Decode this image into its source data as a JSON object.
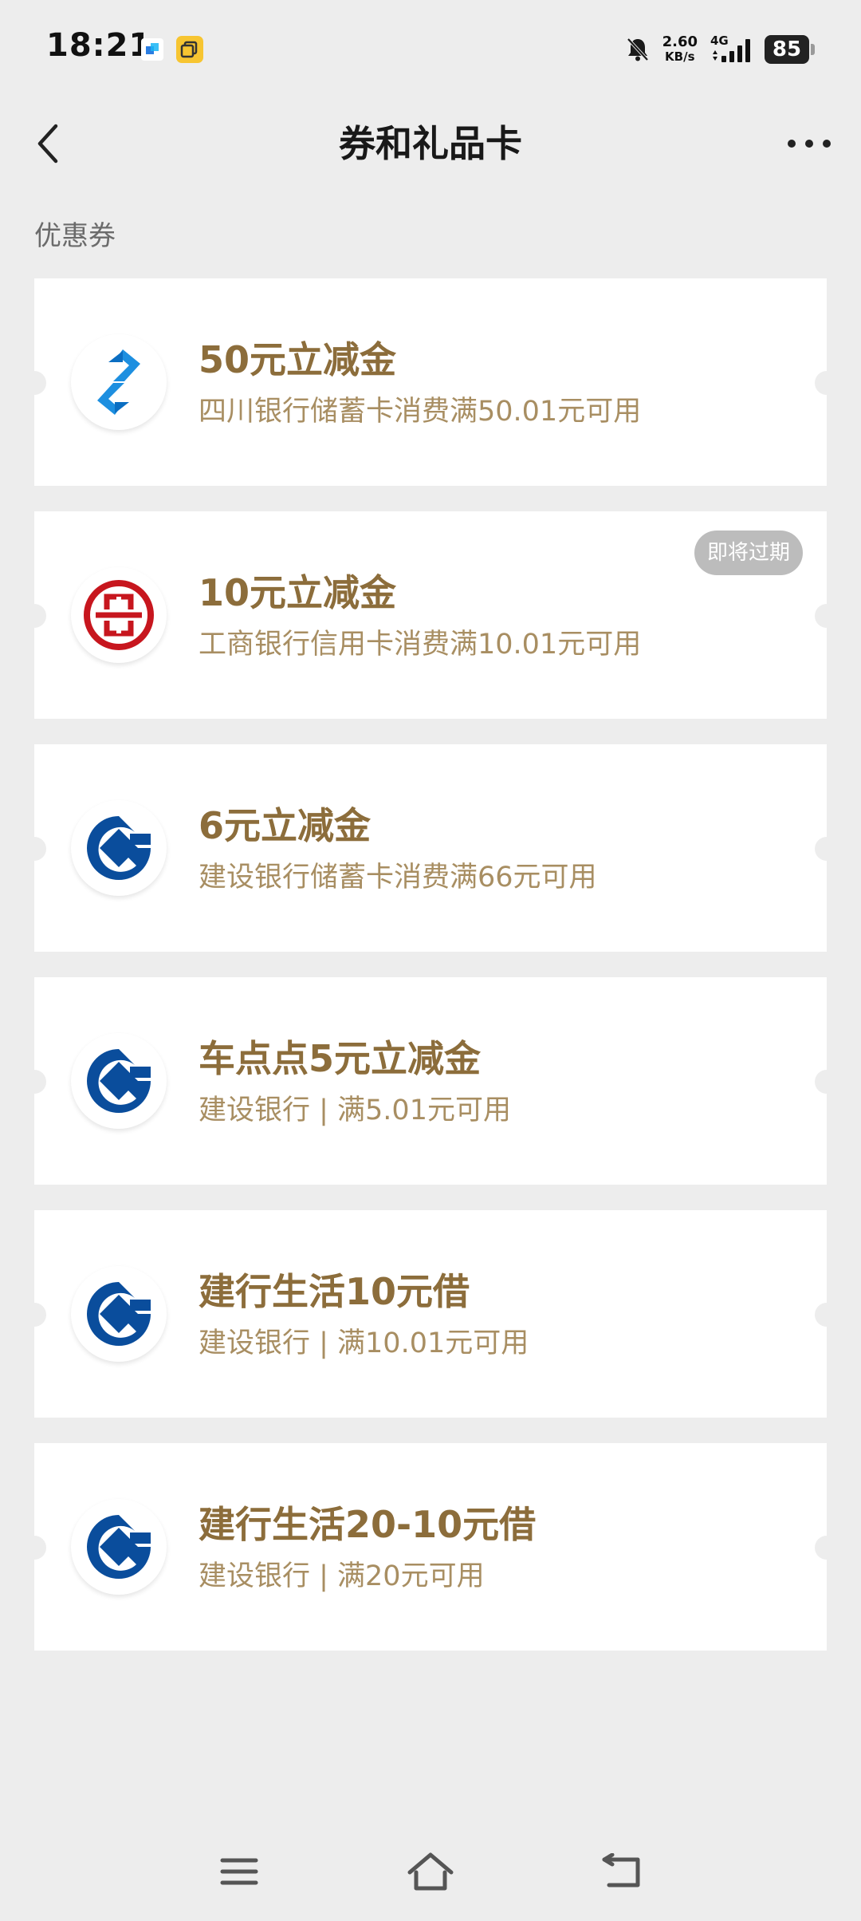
{
  "status_bar": {
    "time": "18:21",
    "net_speed": "2.60",
    "net_speed_unit": "KB/s",
    "network_type": "4G",
    "battery": "85"
  },
  "header": {
    "title": "券和礼品卡",
    "back_icon": "chevron-left-icon",
    "more_icon": "more-horizontal-icon"
  },
  "section": {
    "label": "优惠券"
  },
  "coupons": [
    {
      "logo": "sichuan-bank-logo",
      "title": "50元立减金",
      "desc": "四川银行储蓄卡消费满50.01元可用",
      "badge": ""
    },
    {
      "logo": "icbc-logo",
      "title": "10元立减金",
      "desc": "工商银行信用卡消费满10.01元可用",
      "badge": "即将过期"
    },
    {
      "logo": "ccb-logo",
      "title": "6元立减金",
      "desc": "建设银行储蓄卡消费满66元可用",
      "badge": ""
    },
    {
      "logo": "ccb-logo",
      "title": "车点点5元立减金",
      "desc": "建设银行 | 满5.01元可用",
      "badge": ""
    },
    {
      "logo": "ccb-logo",
      "title": "建行生活10元借",
      "desc": "建设银行 | 满10.01元可用",
      "badge": ""
    },
    {
      "logo": "ccb-logo",
      "title": "建行生活20-10元借",
      "desc": "建设银行 | 满20元可用",
      "badge": ""
    }
  ],
  "colors": {
    "background": "#ededed",
    "title_gold": "#8c6d3b",
    "desc_gold": "#a88e62",
    "ccb_blue": "#0a4d9c",
    "icbc_red": "#c7161e",
    "sichuan_blue": "#1d8fe0"
  },
  "bottom_nav": {
    "menu_icon": "menu-icon",
    "home_icon": "home-icon",
    "back_icon": "back-arrow-icon"
  }
}
